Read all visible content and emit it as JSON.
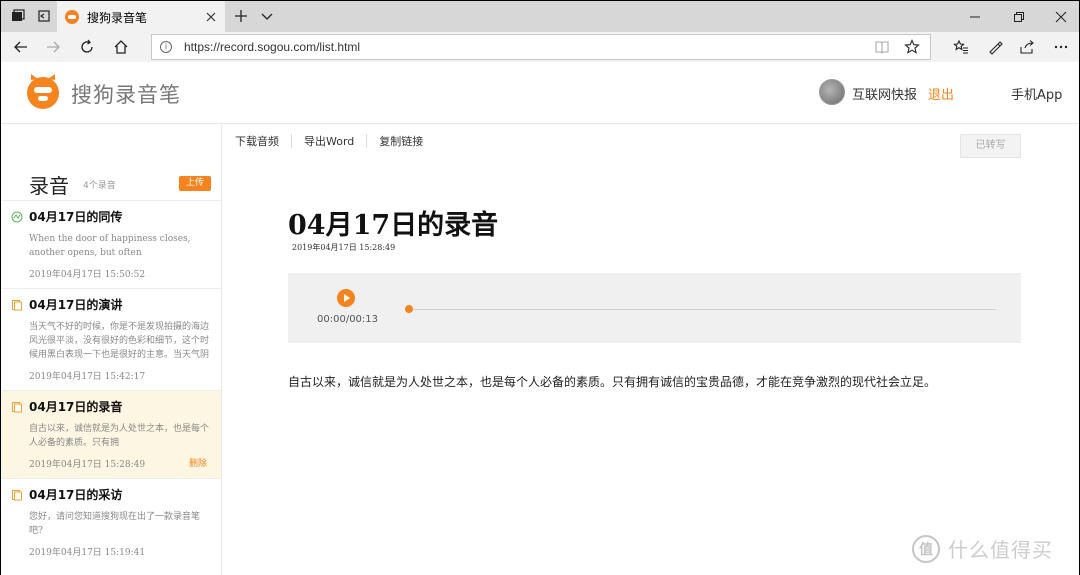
{
  "browser": {
    "tab_title": "搜狗录音笔",
    "url": "https://record.sogou.com/list.html"
  },
  "header": {
    "brand": "搜狗录音笔",
    "username": "互联网快报",
    "logout": "退出",
    "mobile_app": "手机App"
  },
  "sidebar": {
    "title": "录音",
    "count": "4个录音",
    "upload": "上传",
    "items": [
      {
        "title": "04月17日的同传",
        "desc": "When the door of happiness closes, another opens, but often",
        "date": "2019年04月17日 15:50:52",
        "icon": "translate-icon",
        "active": false,
        "delete": ""
      },
      {
        "title": "04月17日的演讲",
        "desc": "当天气不好的时候，你是不是发现拍摄的海边风光很平淡，没有很好的色彩和细节，这个时候用黑白表现一下也是很好的主意。当天气阴",
        "date": "2019年04月17日 15:42:17",
        "icon": "document-icon",
        "active": false,
        "delete": ""
      },
      {
        "title": "04月17日的录音",
        "desc": "自古以来，诚信就是为人处世之本，也是每个人必备的素质。只有拥",
        "date": "2019年04月17日 15:28:49",
        "icon": "document-icon",
        "active": true,
        "delete": "删除"
      },
      {
        "title": "04月17日的采访",
        "desc": "您好，请问您知道搜狗现在出了一款录音笔吧?",
        "date": "2019年04月17日 15:19:41",
        "icon": "document-icon",
        "active": false,
        "delete": ""
      }
    ]
  },
  "main": {
    "toolbar": {
      "download": "下载音频",
      "export": "导出Word",
      "copy": "复制链接"
    },
    "status": "已转写",
    "title": "04月17日的录音",
    "date": "2019年04月17日 15:28:49",
    "player": {
      "time": "00:00/00:13",
      "progress": 0
    },
    "transcript": "自古以来，诚信就是为人处世之本，也是每个人必备的素质。只有拥有诚信的宝贵品德，才能在竞争激烈的现代社会立足。"
  },
  "watermark": {
    "symbol": "值",
    "text": "什么值得买"
  },
  "colors": {
    "accent": "#f5841f",
    "active_row": "#fdf6e3"
  }
}
